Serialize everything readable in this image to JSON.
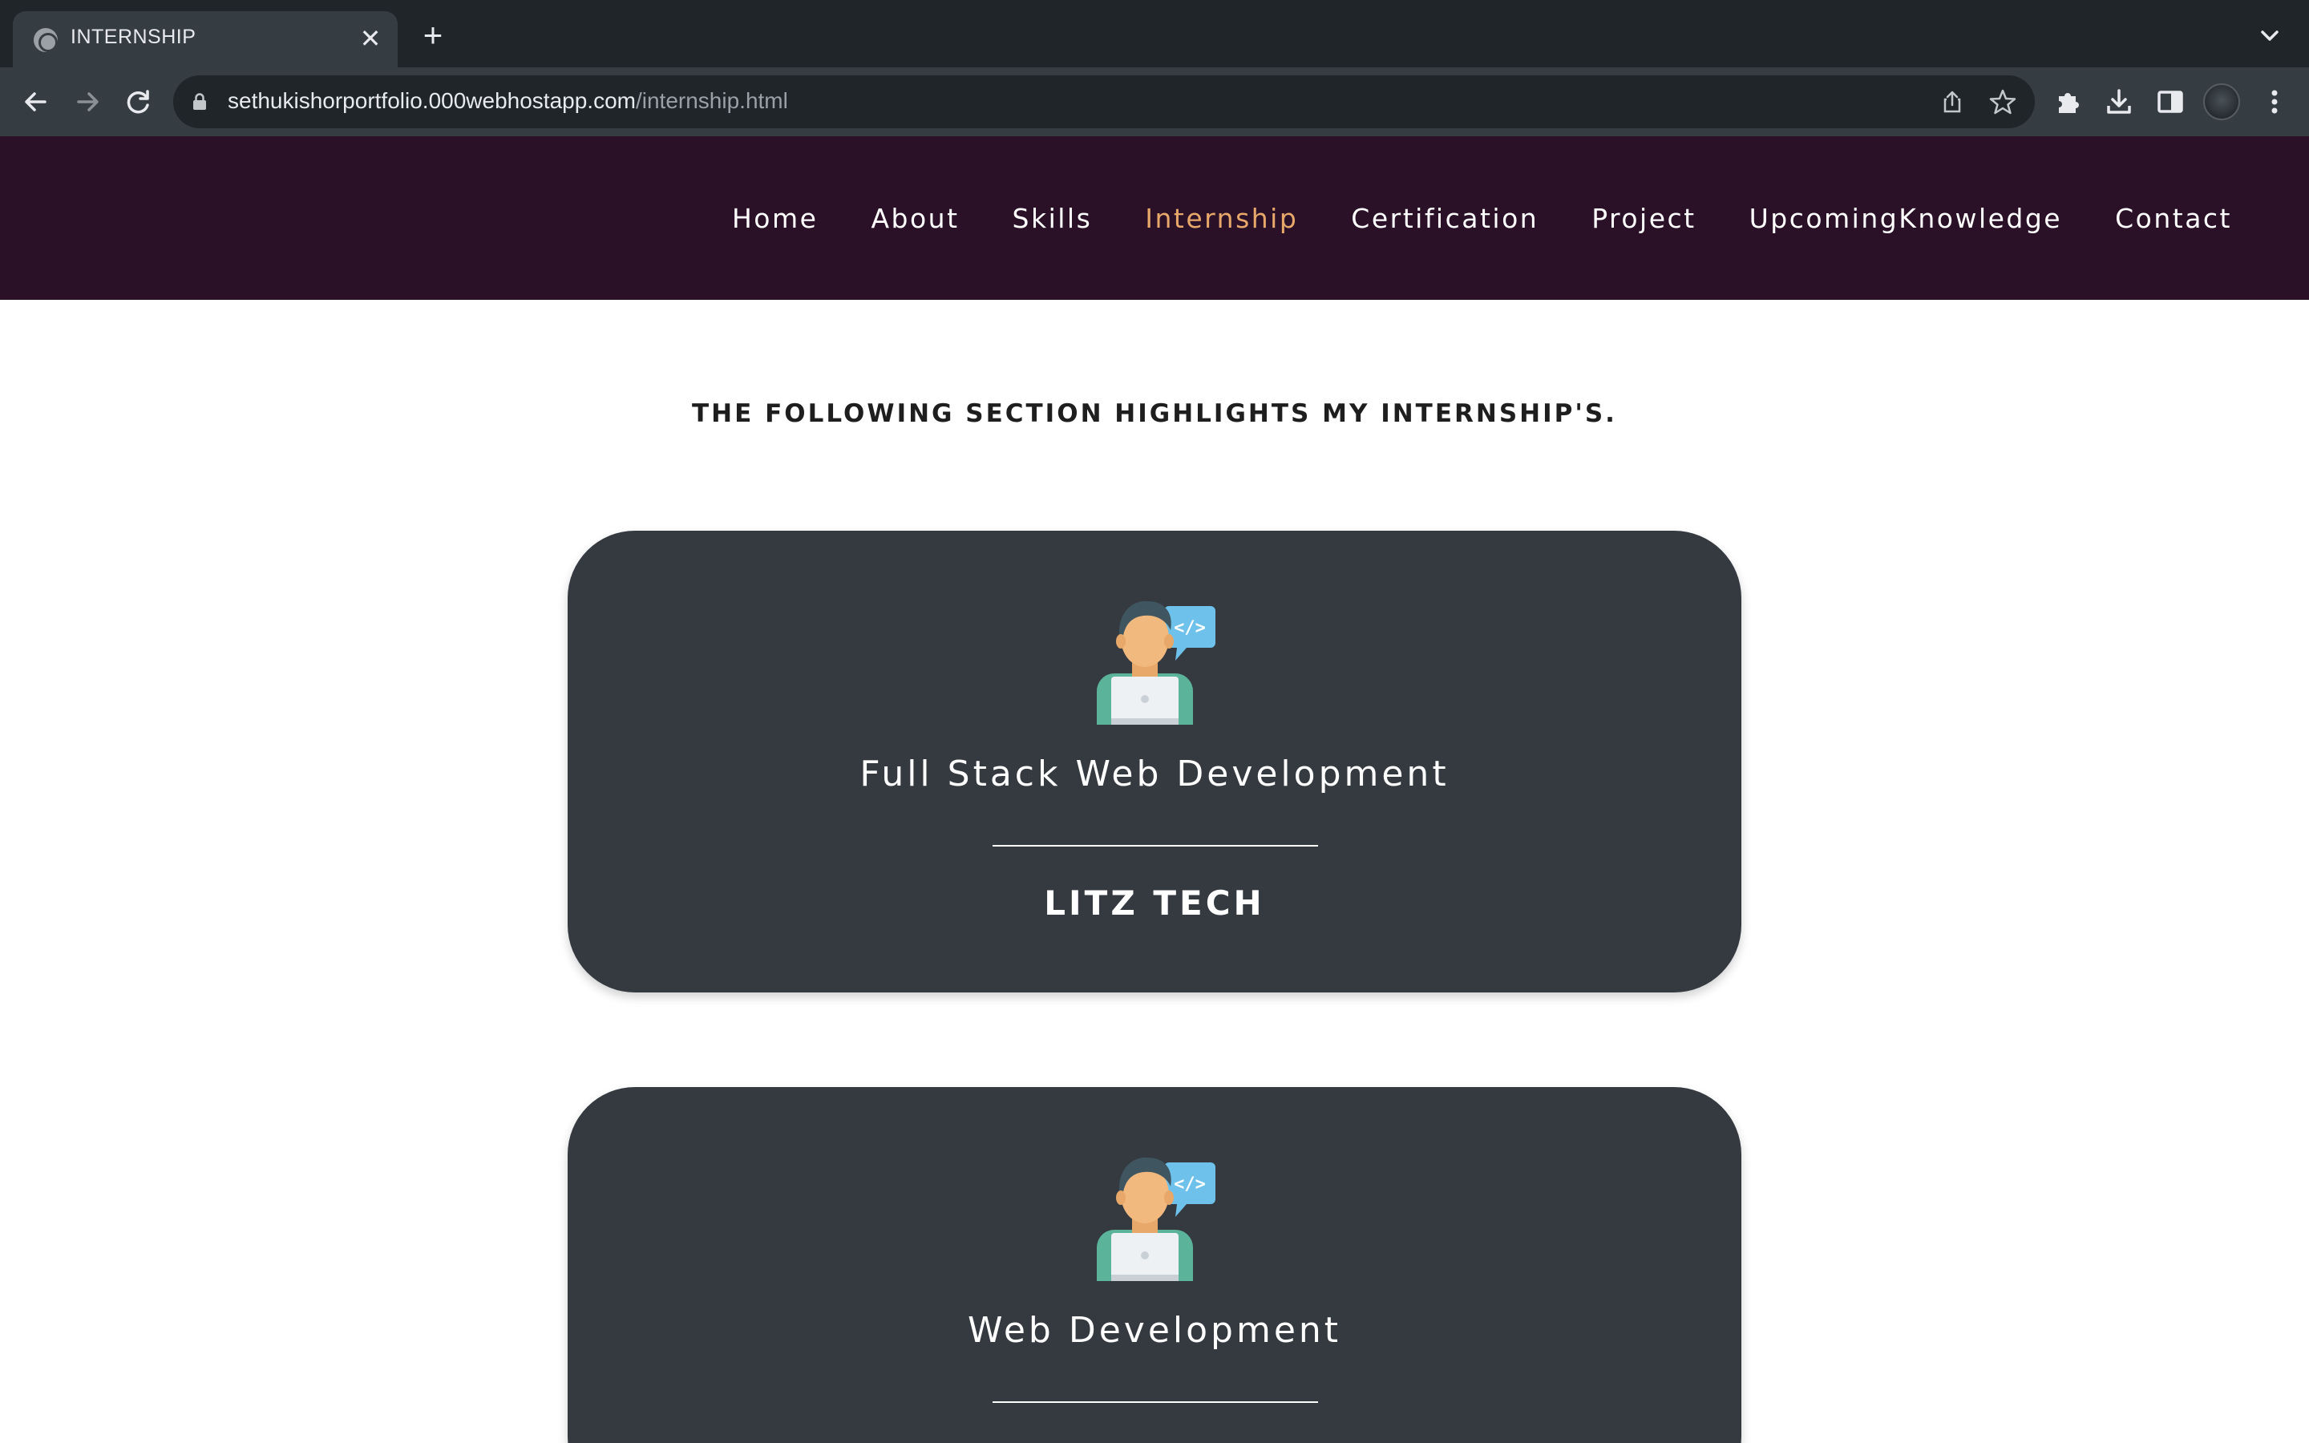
{
  "browser": {
    "tab_title": "INTERNSHIP",
    "tab_close": "✕",
    "new_tab": "+",
    "url_host": "sethukishorportfolio.000webhostapp.com",
    "url_path": "/internship.html"
  },
  "site": {
    "nav": [
      {
        "label": "Home",
        "active": false
      },
      {
        "label": "About",
        "active": false
      },
      {
        "label": "Skills",
        "active": false
      },
      {
        "label": "Internship",
        "active": true
      },
      {
        "label": "Certification",
        "active": false
      },
      {
        "label": "Project",
        "active": false
      },
      {
        "label": "UpcomingKnowledge",
        "active": false
      },
      {
        "label": "Contact",
        "active": false
      }
    ],
    "colors": {
      "header_bg": "#2a1128",
      "active_link": "#e7a86a",
      "card_bg": "#343a40"
    }
  },
  "main": {
    "heading": "THE FOLLOWING SECTION HIGHLIGHTS MY INTERNSHIP'S.",
    "internships": [
      {
        "title": "Full Stack Web Development",
        "company": "LITZ TECH",
        "icon": "developer-icon"
      },
      {
        "title": "Web Development",
        "company": "",
        "icon": "developer-icon"
      }
    ]
  }
}
